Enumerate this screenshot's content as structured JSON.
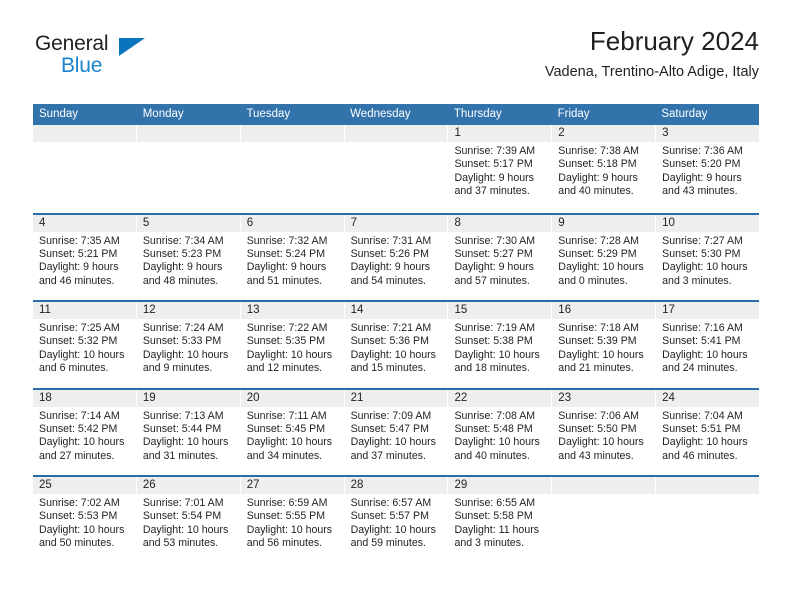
{
  "brand": {
    "name_top": "General",
    "name_bottom": "Blue",
    "triangle_color": "#0a74bd",
    "blue_text_color": "#1b84ce"
  },
  "header": {
    "title": "February 2024",
    "subtitle": "Vadena, Trentino-Alto Adige, Italy"
  },
  "theme": {
    "header_blue": "#3273ac",
    "row_divider_blue": "#2a6ca8",
    "day_band_gray": "#eeeeee",
    "text_color": "#231f20"
  },
  "weekdays": [
    "Sunday",
    "Monday",
    "Tuesday",
    "Wednesday",
    "Thursday",
    "Friday",
    "Saturday"
  ],
  "weeks": [
    [
      {
        "day": "",
        "lines": []
      },
      {
        "day": "",
        "lines": []
      },
      {
        "day": "",
        "lines": []
      },
      {
        "day": "",
        "lines": []
      },
      {
        "day": "1",
        "lines": [
          "Sunrise: 7:39 AM",
          "Sunset: 5:17 PM",
          "Daylight: 9 hours",
          "and 37 minutes."
        ]
      },
      {
        "day": "2",
        "lines": [
          "Sunrise: 7:38 AM",
          "Sunset: 5:18 PM",
          "Daylight: 9 hours",
          "and 40 minutes."
        ]
      },
      {
        "day": "3",
        "lines": [
          "Sunrise: 7:36 AM",
          "Sunset: 5:20 PM",
          "Daylight: 9 hours",
          "and 43 minutes."
        ]
      }
    ],
    [
      {
        "day": "4",
        "lines": [
          "Sunrise: 7:35 AM",
          "Sunset: 5:21 PM",
          "Daylight: 9 hours",
          "and 46 minutes."
        ]
      },
      {
        "day": "5",
        "lines": [
          "Sunrise: 7:34 AM",
          "Sunset: 5:23 PM",
          "Daylight: 9 hours",
          "and 48 minutes."
        ]
      },
      {
        "day": "6",
        "lines": [
          "Sunrise: 7:32 AM",
          "Sunset: 5:24 PM",
          "Daylight: 9 hours",
          "and 51 minutes."
        ]
      },
      {
        "day": "7",
        "lines": [
          "Sunrise: 7:31 AM",
          "Sunset: 5:26 PM",
          "Daylight: 9 hours",
          "and 54 minutes."
        ]
      },
      {
        "day": "8",
        "lines": [
          "Sunrise: 7:30 AM",
          "Sunset: 5:27 PM",
          "Daylight: 9 hours",
          "and 57 minutes."
        ]
      },
      {
        "day": "9",
        "lines": [
          "Sunrise: 7:28 AM",
          "Sunset: 5:29 PM",
          "Daylight: 10 hours",
          "and 0 minutes."
        ]
      },
      {
        "day": "10",
        "lines": [
          "Sunrise: 7:27 AM",
          "Sunset: 5:30 PM",
          "Daylight: 10 hours",
          "and 3 minutes."
        ]
      }
    ],
    [
      {
        "day": "11",
        "lines": [
          "Sunrise: 7:25 AM",
          "Sunset: 5:32 PM",
          "Daylight: 10 hours",
          "and 6 minutes."
        ]
      },
      {
        "day": "12",
        "lines": [
          "Sunrise: 7:24 AM",
          "Sunset: 5:33 PM",
          "Daylight: 10 hours",
          "and 9 minutes."
        ]
      },
      {
        "day": "13",
        "lines": [
          "Sunrise: 7:22 AM",
          "Sunset: 5:35 PM",
          "Daylight: 10 hours",
          "and 12 minutes."
        ]
      },
      {
        "day": "14",
        "lines": [
          "Sunrise: 7:21 AM",
          "Sunset: 5:36 PM",
          "Daylight: 10 hours",
          "and 15 minutes."
        ]
      },
      {
        "day": "15",
        "lines": [
          "Sunrise: 7:19 AM",
          "Sunset: 5:38 PM",
          "Daylight: 10 hours",
          "and 18 minutes."
        ]
      },
      {
        "day": "16",
        "lines": [
          "Sunrise: 7:18 AM",
          "Sunset: 5:39 PM",
          "Daylight: 10 hours",
          "and 21 minutes."
        ]
      },
      {
        "day": "17",
        "lines": [
          "Sunrise: 7:16 AM",
          "Sunset: 5:41 PM",
          "Daylight: 10 hours",
          "and 24 minutes."
        ]
      }
    ],
    [
      {
        "day": "18",
        "lines": [
          "Sunrise: 7:14 AM",
          "Sunset: 5:42 PM",
          "Daylight: 10 hours",
          "and 27 minutes."
        ]
      },
      {
        "day": "19",
        "lines": [
          "Sunrise: 7:13 AM",
          "Sunset: 5:44 PM",
          "Daylight: 10 hours",
          "and 31 minutes."
        ]
      },
      {
        "day": "20",
        "lines": [
          "Sunrise: 7:11 AM",
          "Sunset: 5:45 PM",
          "Daylight: 10 hours",
          "and 34 minutes."
        ]
      },
      {
        "day": "21",
        "lines": [
          "Sunrise: 7:09 AM",
          "Sunset: 5:47 PM",
          "Daylight: 10 hours",
          "and 37 minutes."
        ]
      },
      {
        "day": "22",
        "lines": [
          "Sunrise: 7:08 AM",
          "Sunset: 5:48 PM",
          "Daylight: 10 hours",
          "and 40 minutes."
        ]
      },
      {
        "day": "23",
        "lines": [
          "Sunrise: 7:06 AM",
          "Sunset: 5:50 PM",
          "Daylight: 10 hours",
          "and 43 minutes."
        ]
      },
      {
        "day": "24",
        "lines": [
          "Sunrise: 7:04 AM",
          "Sunset: 5:51 PM",
          "Daylight: 10 hours",
          "and 46 minutes."
        ]
      }
    ],
    [
      {
        "day": "25",
        "lines": [
          "Sunrise: 7:02 AM",
          "Sunset: 5:53 PM",
          "Daylight: 10 hours",
          "and 50 minutes."
        ]
      },
      {
        "day": "26",
        "lines": [
          "Sunrise: 7:01 AM",
          "Sunset: 5:54 PM",
          "Daylight: 10 hours",
          "and 53 minutes."
        ]
      },
      {
        "day": "27",
        "lines": [
          "Sunrise: 6:59 AM",
          "Sunset: 5:55 PM",
          "Daylight: 10 hours",
          "and 56 minutes."
        ]
      },
      {
        "day": "28",
        "lines": [
          "Sunrise: 6:57 AM",
          "Sunset: 5:57 PM",
          "Daylight: 10 hours",
          "and 59 minutes."
        ]
      },
      {
        "day": "29",
        "lines": [
          "Sunrise: 6:55 AM",
          "Sunset: 5:58 PM",
          "Daylight: 11 hours",
          "and 3 minutes."
        ]
      },
      {
        "day": "",
        "lines": []
      },
      {
        "day": "",
        "lines": []
      }
    ]
  ]
}
